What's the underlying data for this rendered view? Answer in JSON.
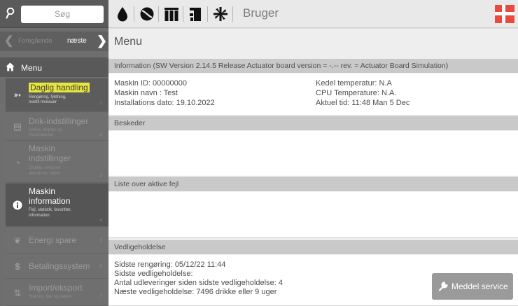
{
  "sidebar": {
    "search_placeholder": "Søg",
    "nav_prev_label": "Foregående",
    "nav_next_label": "næste",
    "menu_label": "Menu",
    "items": [
      {
        "title": "Daglig handling",
        "sub1": "Rengøring, fyldning,",
        "sub2": "nulstil niveauer",
        "num": "1",
        "icon": "daily-icon"
      },
      {
        "title": "Drik-indstillinger",
        "sub1": "Drikke, display og",
        "sub2": "maskinlayout",
        "num": "2",
        "icon": "drink-icon"
      },
      {
        "title1": "Maskin",
        "title2": "indstillinger",
        "sub1": "Display, sensorer,",
        "sub2": "aktuatorer, kedel",
        "num": "3",
        "icon": "gauge-icon"
      },
      {
        "title1": "Maskin",
        "title2": "information",
        "sub1": "Fejl, statistik, favoritter,",
        "sub2": "information",
        "num": "4",
        "icon": "info-icon"
      },
      {
        "title": "Energi spare",
        "num": "5",
        "icon": "leaf-icon"
      },
      {
        "title": "Betalingssystem",
        "num": "6",
        "icon": "dollar-icon"
      },
      {
        "title": "Import/eksport",
        "sub1": "Statistik, filer og pakker",
        "num": "7",
        "icon": "transfer-icon"
      }
    ]
  },
  "topbar": {
    "user_label": "Bruger",
    "icons": [
      "drop-icon",
      "bean-icon",
      "container-icon",
      "machine-icon",
      "fan-icon"
    ]
  },
  "main": {
    "title": "Menu",
    "info_header": "Information (SW Version 2.14.5 Release   Actuator board version = -.-- rev. = Actuator Board Simulation)",
    "info": {
      "machine_id": "Maskin ID: 00000000",
      "machine_name": "Maskin navn : Test",
      "install_date": "Installations dato: 19.10.2022",
      "boiler_temp": "Kedel temperatur: N.A",
      "cpu_temp": "CPU Temperature: N.A.",
      "current_time": "Aktuel tid: 11:48  Man 5 Dec"
    },
    "messages_header": "Beskeder",
    "errors_header": "Liste over aktive fejl",
    "maintenance_header": "Vedligeholdelse",
    "maintenance": {
      "last_cleaning": "Sidste rengøring: 05/12/22 11:44",
      "last_maintenance": "Sidste vedligeholdelse:",
      "dispenses_since": "Antal udleveringer siden sidste vedligeholdelse: 4",
      "next_maintenance": "Næste vedligeholdelse: 7496 drikke eller 9 uger"
    },
    "service_button": "Meddel service"
  }
}
